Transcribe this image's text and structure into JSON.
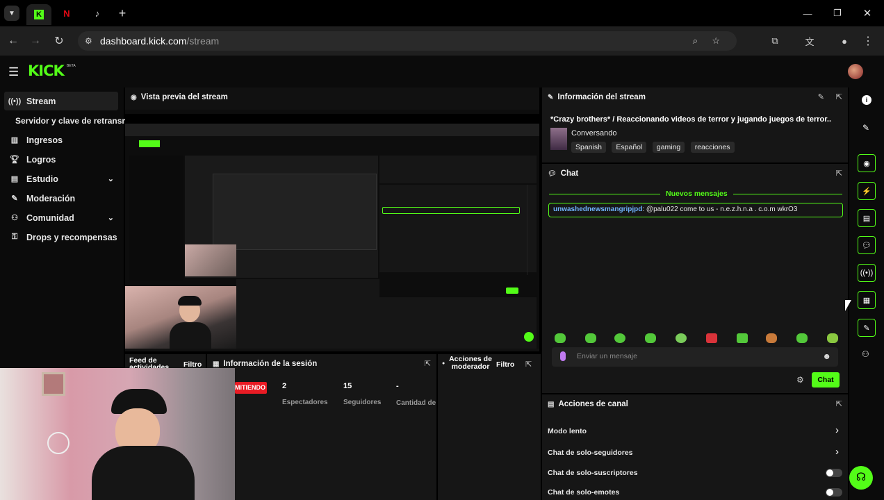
{
  "browser": {
    "tabs": [
      {
        "name": "kick-tab",
        "label": "K"
      },
      {
        "name": "netflix-tab",
        "label": "N"
      },
      {
        "name": "tiktok-tab",
        "label": "♪"
      }
    ],
    "url_host": "dashboard.kick.com",
    "url_path": "/stream"
  },
  "app": {
    "logo": "KICK",
    "logo_beta": "BETA"
  },
  "sidebar": {
    "items": [
      {
        "label": "Stream",
        "icon": "broadcast-icon"
      },
      {
        "label": "Servidor y clave de retransm",
        "icon": ""
      },
      {
        "label": "Ingresos",
        "icon": "chart-icon"
      },
      {
        "label": "Logros",
        "icon": "trophy-icon"
      },
      {
        "label": "Estudio",
        "icon": "studio-icon"
      },
      {
        "label": "Moderación",
        "icon": "wrench-icon"
      },
      {
        "label": "Comunidad",
        "icon": "community-icon"
      },
      {
        "label": "Drops y recompensas",
        "icon": "drops-icon"
      }
    ]
  },
  "preview": {
    "title": "Vista previa del stream"
  },
  "stream_info": {
    "title": "Información del stream",
    "stream_title": "*Crazy brothers* / Reaccionando videos de terror y jugando juegos de terror..",
    "category": "Conversando",
    "tags": [
      "Spanish",
      "Español",
      "gaming",
      "reacciones"
    ]
  },
  "chat": {
    "title": "Chat",
    "new_messages": "Nuevos mensajes",
    "message_user": "unwashednewsmangripjpd",
    "message_text": ": @palu022 come to us - n.e.z.h.n.a . c.o.m wkrO3",
    "input_placeholder": "Enviar un mensaje",
    "send_label": "Chat"
  },
  "activity": {
    "title": "Feed de actividades",
    "filter": "Filtro"
  },
  "session": {
    "title": "Información de la sesión",
    "live_badge": "MITIENDO",
    "stats": [
      {
        "value": "2",
        "label": "Espectadores"
      },
      {
        "value": "15",
        "label": "Seguidores"
      },
      {
        "value": "-",
        "label": "Cantidad de suscripcione"
      }
    ]
  },
  "mod_actions": {
    "title": "Acciones de moderador",
    "filter": "Filtro"
  },
  "channel_actions": {
    "title": "Acciones de canal",
    "rows": [
      {
        "label": "Modo lento",
        "control": "chevron"
      },
      {
        "label": "Chat de solo-seguidores",
        "control": "chevron"
      },
      {
        "label": "Chat de solo-suscriptores",
        "control": "toggle"
      },
      {
        "label": "Chat de solo-emotes",
        "control": "toggle"
      }
    ]
  },
  "colors": {
    "accent": "#53fc18",
    "panel": "#161616",
    "background": "#000000",
    "live": "#e81b24"
  }
}
